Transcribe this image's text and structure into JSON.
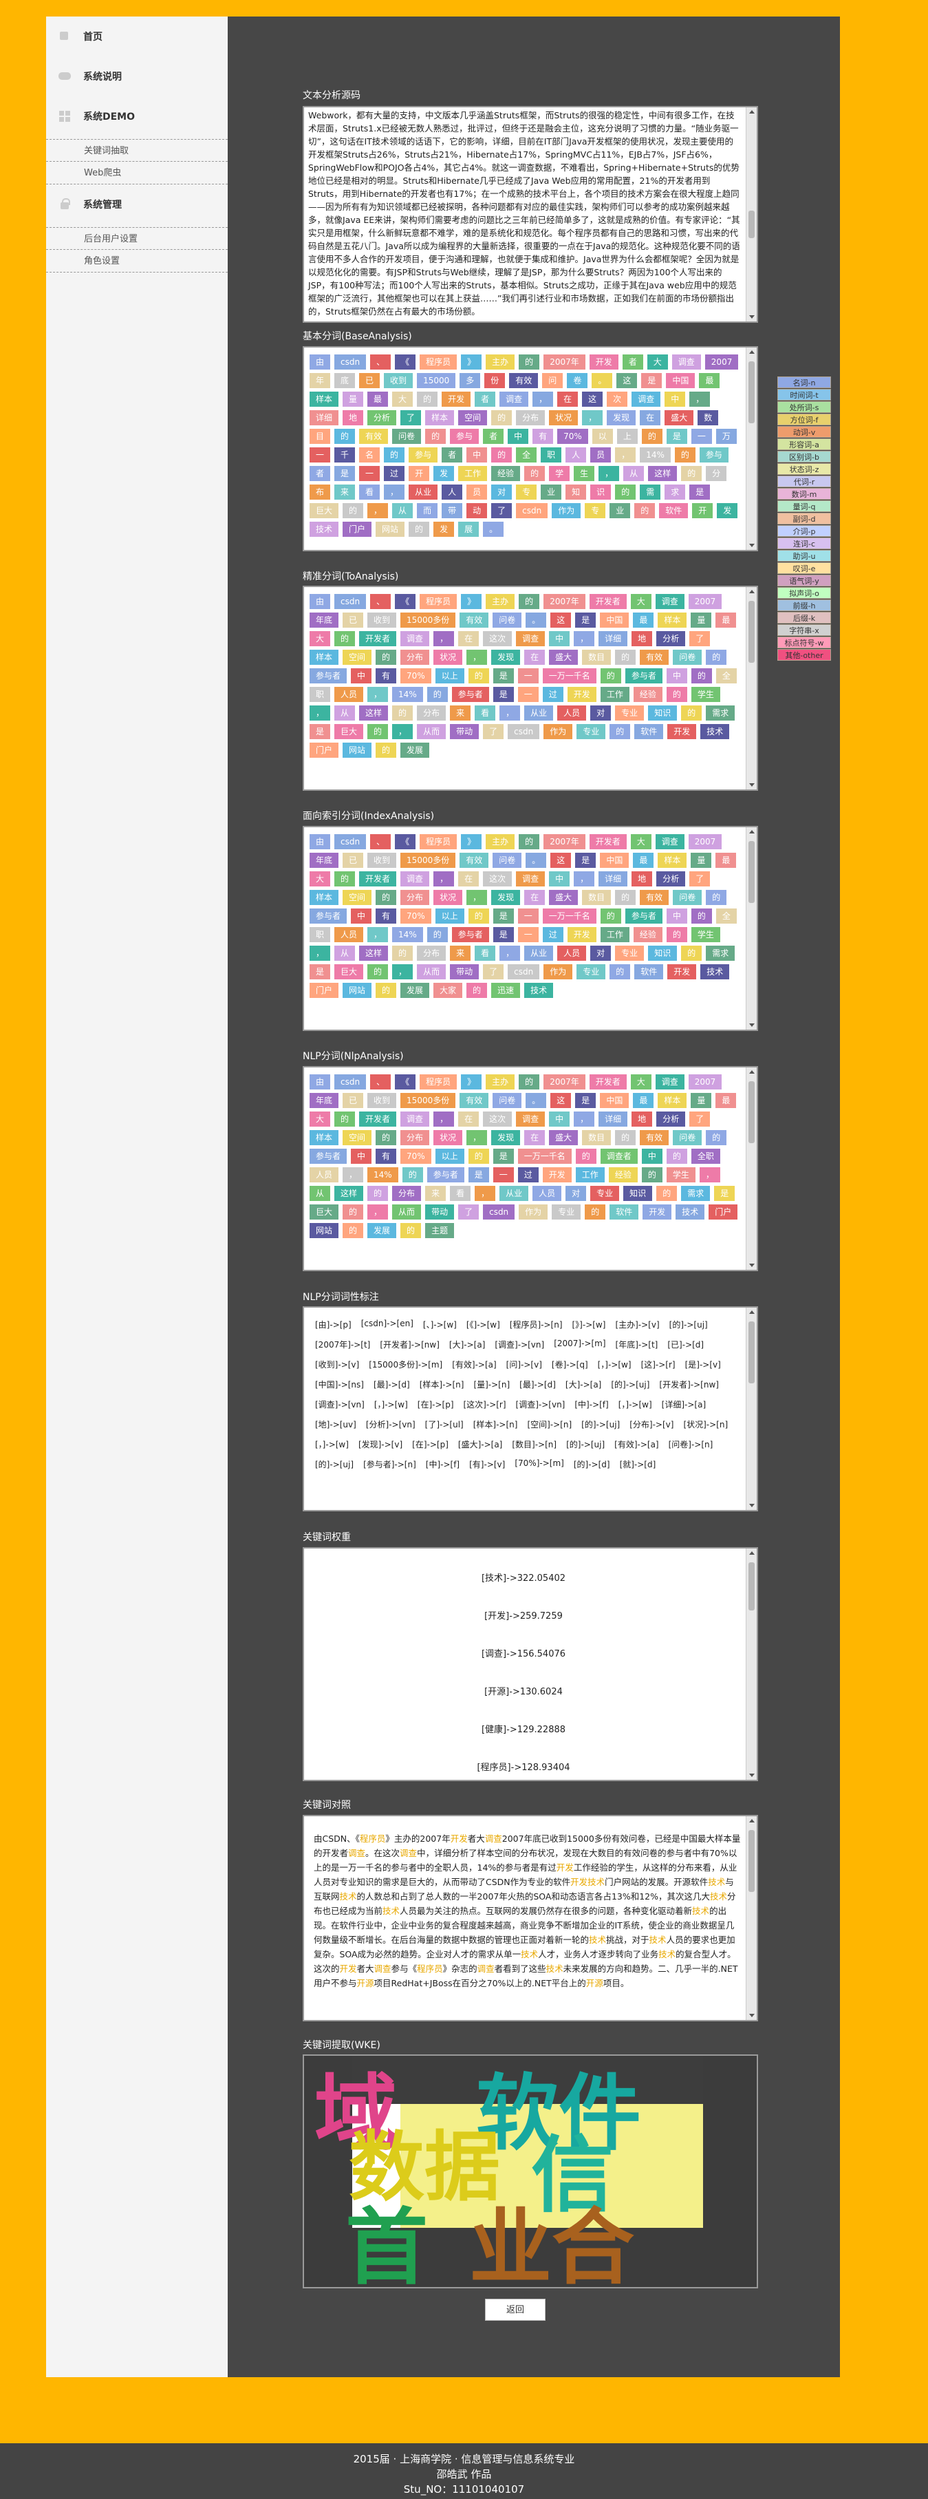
{
  "sidebar": {
    "nav": [
      {
        "label": "首页",
        "icon": "home-icon"
      },
      {
        "label": "系统说明",
        "icon": "chat-icon"
      },
      {
        "label": "系统DEMO",
        "icon": "grid-icon"
      }
    ],
    "demo_sub": [
      "关键词抽取",
      "Web爬虫"
    ],
    "admin": {
      "label": "系统管理",
      "icon": "lock-icon"
    },
    "admin_sub": [
      "后台用户设置",
      "角色设置"
    ]
  },
  "sections": {
    "source": "文本分析源码",
    "base": "基本分词(BaseAnalysis)",
    "to": "精准分词(ToAnalysis)",
    "index": "面向索引分词(IndexAnalysis)",
    "nlp": "NLP分词(NlpAnalysis)",
    "nlp_attr": "NLP分词词性标注",
    "weight": "关键词权重",
    "highlight": "关键词对照",
    "cloud": "关键词提取(WKE)"
  },
  "source_text": "Webwork，都有大量的支持，中文版本几乎涵盖Struts框架，而Struts的很强的稳定性，中间有很多工作，在技术层面，Struts1.x已经被无数人熟悉过，批评过，但终于还是融会主位，这充分说明了习惯的力量。“随业务驱一切”，这句话在IT技术领域的话语下，它的影响，详细，目前在IT部门Java开发框架的使用状况，发现主要使用的开发框架Struts占26%，Struts占21%，Hibernate占17%，SpringMVC占11%，EJB占7%，JSF占6%，SpringWebFlow和POJO各占4%，其它占4%。就这一调查数据，不难看出，Spring+Hibernate+Struts的优势地位已经是相对的明显。Struts和Hibernate几乎已经成了Java Web应用的常用配置，21%的开发者用到Struts，用到Hibernate的开发者也有17%；在一个成熟的技术平台上，各个项目的技术方案会在很大程度上趋同——因为所有有为知识领域都已经被探明，各种问题都有对应的最佳实践，架构师们可以参考的成功案例越来越多，就像Java EE来讲，架构师们需要考虑的问题比之三年前已经简单多了，这就是成熟的价值。有专家评论：“其实只是用框架，什么新鲜玩意都不难学，难的是系统化和规范化。每个程序员都有自己的思路和习惯，写出来的代码自然是五花八门。Java所以成为编程界的大量新选择，很重要的一点在于Java的规范化。这种规范化要不同的语言使用不多人合作的开发项目，便于沟通和理解，也就便于集成和维护。Java世界为什么会都框架呢？全因为就是以规范化化的需要。有JSP和Struts与Web继续，理解了是JSP，那为什么要Struts？两因为100个人写出来的JSP，有100种写法；而100个人写出来的Struts，基本相似。Struts之成功，正缘于其在Java web应用中的规范框架的广泛流行，其他框架也可以在其上获益……”我们再引述行业和市场数据，正如我们在前面的市场份额指出的，Struts框架仍然在占有最大的市场份额。",
  "tag_colors": [
    "#c9c9c9",
    "#72c471",
    "#5bb8df",
    "#8fa8e4",
    "#a06ec4",
    "#f09090",
    "#5a5aa0",
    "#ef9a4a",
    "#3cb4a0",
    "#eed555",
    "#86a8e0",
    "#e4d3a6",
    "#ee7ba8",
    "#ffa57e",
    "#70c8c8",
    "#cfa1e0",
    "#66aa88",
    "#e46060"
  ],
  "base_tokens": [
    "由",
    "csdn",
    "、",
    "《",
    "程序员",
    "》",
    "主办",
    "的",
    "2007年",
    "开发",
    "者",
    "大",
    "调查",
    "2007",
    "年",
    "底",
    "已",
    "收到",
    "15000",
    "多",
    "份",
    "有效",
    "问",
    "卷",
    "。",
    "这",
    "是",
    "中国",
    "最",
    "样本",
    "量",
    "最",
    "大",
    "的",
    "开发",
    "者",
    "调查",
    "，",
    "在",
    "这",
    "次",
    "调查",
    "中",
    "，",
    "详细",
    "地",
    "分析",
    "了",
    "样本",
    "空间",
    "的",
    "分布",
    "状况",
    "，",
    "发现",
    "在",
    "盛大",
    "数",
    "目",
    "的",
    "有效",
    "问卷",
    "的",
    "参与",
    "者",
    "中",
    "有",
    "70%",
    "以",
    "上",
    "的",
    "是",
    "一",
    "万",
    "一",
    "千",
    "名",
    "的",
    "参与",
    "者",
    "中",
    "的",
    "全",
    "职",
    "人",
    "员",
    "，",
    "14%",
    "的",
    "参与",
    "者",
    "是",
    "一",
    "过",
    "开",
    "发",
    "工作",
    "经验",
    "的",
    "学",
    "生",
    "，",
    "从",
    "这样",
    "的",
    "分",
    "布",
    "来",
    "看",
    "，",
    "从业",
    "人",
    "员",
    "对",
    "专",
    "业",
    "知",
    "识",
    "的",
    "需",
    "求",
    "是",
    "巨大",
    "的",
    "，",
    "从",
    "而",
    "带",
    "动",
    "了",
    "csdn",
    "作为",
    "专",
    "业",
    "的",
    "软件",
    "开",
    "发",
    "技术",
    "门户",
    "网站",
    "的",
    "发",
    "展",
    "。"
  ],
  "to_tokens": [
    "由",
    "csdn",
    "、",
    "《",
    "程序员",
    "》",
    "主办",
    "的",
    "2007年",
    "开发者",
    "大",
    "调查",
    "2007",
    "年底",
    "已",
    "收到",
    "15000多份",
    "有效",
    "问卷",
    "。",
    "这",
    "是",
    "中国",
    "最",
    "样本",
    "量",
    "最",
    "大",
    "的",
    "开发者",
    "调查",
    "，",
    "在",
    "这次",
    "调查",
    "中",
    "，",
    "详细",
    "地",
    "分析",
    "了",
    "样本",
    "空间",
    "的",
    "分布",
    "状况",
    "，",
    "发现",
    "在",
    "盛大",
    "数目",
    "的",
    "有效",
    "问卷",
    "的",
    "参与者",
    "中",
    "有",
    "70%",
    "以上",
    "的",
    "是",
    "一",
    "一万一千名",
    "的",
    "参与者",
    "中",
    "的",
    "全",
    "职",
    "人员",
    "，",
    "14%",
    "的",
    "参与者",
    "是",
    "一",
    "过",
    "开发",
    "工作",
    "经验",
    "的",
    "学生",
    "，",
    "从",
    "这样",
    "的",
    "分布",
    "来",
    "看",
    "，",
    "从业",
    "人员",
    "对",
    "专业",
    "知识",
    "的",
    "需求",
    "是",
    "巨大",
    "的",
    "，",
    "从而",
    "带动",
    "了",
    "csdn",
    "作为",
    "专业",
    "的",
    "软件",
    "开发",
    "技术",
    "门户",
    "网站",
    "的",
    "发展"
  ],
  "index_tokens": [
    "由",
    "csdn",
    "、",
    "《",
    "程序员",
    "》",
    "主办",
    "的",
    "2007年",
    "开发者",
    "大",
    "调查",
    "2007",
    "年底",
    "已",
    "收到",
    "15000多份",
    "有效",
    "问卷",
    "。",
    "这",
    "是",
    "中国",
    "最",
    "样本",
    "量",
    "最",
    "大",
    "的",
    "开发者",
    "调查",
    "，",
    "在",
    "这次",
    "调查",
    "中",
    "，",
    "详细",
    "地",
    "分析",
    "了",
    "样本",
    "空间",
    "的",
    "分布",
    "状况",
    "，",
    "发现",
    "在",
    "盛大",
    "数目",
    "的",
    "有效",
    "问卷",
    "的",
    "参与者",
    "中",
    "有",
    "70%",
    "以上",
    "的",
    "是",
    "一",
    "一万一千名",
    "的",
    "参与者",
    "中",
    "的",
    "全",
    "职",
    "人员",
    "，",
    "14%",
    "的",
    "参与者",
    "是",
    "一",
    "过",
    "开发",
    "工作",
    "经验",
    "的",
    "学生",
    "，",
    "从",
    "这样",
    "的",
    "分布",
    "来",
    "看",
    "，",
    "从业",
    "人员",
    "对",
    "专业",
    "知识",
    "的",
    "需求",
    "是",
    "巨大",
    "的",
    "，",
    "从而",
    "带动",
    "了",
    "csdn",
    "作为",
    "专业",
    "的",
    "软件",
    "开发",
    "技术",
    "门户",
    "网站",
    "的",
    "发展",
    "大家",
    "的",
    "迅速",
    "技术"
  ],
  "nlp_tokens": [
    "由",
    "csdn",
    "、",
    "《",
    "程序员",
    "》",
    "主办",
    "的",
    "2007年",
    "开发者",
    "大",
    "调查",
    "2007",
    "年底",
    "已",
    "收到",
    "15000多份",
    "有效",
    "问卷",
    "。",
    "这",
    "是",
    "中国",
    "最",
    "样本",
    "量",
    "最",
    "大",
    "的",
    "开发者",
    "调查",
    "，",
    "在",
    "这次",
    "调查",
    "中",
    "，",
    "详细",
    "地",
    "分析",
    "了",
    "样本",
    "空间",
    "的",
    "分布",
    "状况",
    "，",
    "发现",
    "在",
    "盛大",
    "数目",
    "的",
    "有效",
    "问卷",
    "的",
    "参与者",
    "中",
    "有",
    "70%",
    "以上",
    "的",
    "是",
    "一万一千名",
    "的",
    "调查者",
    "中",
    "的",
    "全职",
    "人员",
    "，",
    "14%",
    "的",
    "参与者",
    "是",
    "一",
    "过",
    "开发",
    "工作",
    "经验",
    "的",
    "学生",
    "，",
    "从",
    "这样",
    "的",
    "分布",
    "来",
    "看",
    "，",
    "从业",
    "人员",
    "对",
    "专业",
    "知识",
    "的",
    "需求",
    "是",
    "巨大",
    "的",
    "，",
    "从而",
    "带动",
    "了",
    "csdn",
    "作为",
    "专业",
    "的",
    "软件",
    "开发",
    "技术",
    "门户",
    "网站",
    "的",
    "发展",
    "的",
    "主题"
  ],
  "nlp_attrs": [
    "[由]->[p]",
    "[csdn]->[en]",
    "[、]->[w]",
    "[《]->[w]",
    "[程序员]->[n]",
    "[》]->[w]",
    "[主办]->[v]",
    "[的]->[uj]",
    "[2007年]->[t]",
    "[开发者]->[nw]",
    "[大]->[a]",
    "[调查]->[vn]",
    "[2007]->[m]",
    "[年底]->[t]",
    "[已]->[d]",
    "[收到]->[v]",
    "[15000多份]->[m]",
    "[有效]->[a]",
    "[问]->[v]",
    "[卷]->[q]",
    "[，]->[w]",
    "[这]->[r]",
    "[是]->[v]",
    "[中国]->[ns]",
    "[最]->[d]",
    "[样本]->[n]",
    "[量]->[n]",
    "[最]->[d]",
    "[大]->[a]",
    "[的]->[uj]",
    "[开发者]->[nw]",
    "[调查]->[vn]",
    "[，]->[w]",
    "[在]->[p]",
    "[这次]->[r]",
    "[调查]->[vn]",
    "[中]->[f]",
    "[，]->[w]",
    "[详细]->[a]",
    "[地]->[uv]",
    "[分析]->[vn]",
    "[了]->[ul]",
    "[样本]->[n]",
    "[空间]->[n]",
    "[的]->[uj]",
    "[分布]->[v]",
    "[状况]->[n]",
    "[，]->[w]",
    "[发现]->[v]",
    "[在]->[p]",
    "[盛大]->[a]",
    "[数目]->[n]",
    "[的]->[uj]",
    "[有效]->[a]",
    "[问卷]->[n]",
    "[的]->[uj]",
    "[参与者]->[n]",
    "[中]->[f]",
    "[有]->[v]",
    "[70%]->[m]",
    "[的]->[d]",
    "[就]->[d]"
  ],
  "weights": [
    "[技术]->322.05402",
    "[开发]->259.7259",
    "[调查]->156.54076",
    "[开源]->130.6024",
    "[健康]->129.22888",
    "[程序员]->128.93404"
  ],
  "highlight_text": [
    {
      "t": "由CSDN、《"
    },
    {
      "t": "程序员",
      "k": 1
    },
    {
      "t": "》主办的2007年"
    },
    {
      "t": "开发",
      "k": 1
    },
    {
      "t": "者大"
    },
    {
      "t": "调查",
      "k": 1
    },
    {
      "t": "2007年底已收到15000多份有效问卷，已经是中国最大样本量的开发者"
    },
    {
      "t": "调查",
      "k": 1
    },
    {
      "t": "。在这次"
    },
    {
      "t": "调查",
      "k": 1
    },
    {
      "t": "中，详细分析了样本空间的分布状况，发现在大数目的有效问卷的参与者中有70%以上的是一万一千名的参与者中的全职人员，14%的参与者是有过"
    },
    {
      "t": "开发",
      "k": 1
    },
    {
      "t": "工作经验的学生，从这样的分布来看，从业人员对专业知识的需求是巨大的，从而带动了CSDN作为专业的软件"
    },
    {
      "t": "开发",
      "k": 1
    },
    {
      "t": "技术",
      "k": 1
    },
    {
      "t": "门户网站的发展。开源软件"
    },
    {
      "t": "技术",
      "k": 1
    },
    {
      "t": "与互联网"
    },
    {
      "t": "技术",
      "k": 1
    },
    {
      "t": "的人数总和占到了总人数的一半2007年火热的SOA和动态语言各占13%和12%，其次这几大"
    },
    {
      "t": "技术",
      "k": 1
    },
    {
      "t": "分布也已经成为当前"
    },
    {
      "t": "技术",
      "k": 1
    },
    {
      "t": "人员最为关注的热点。互联网的发展仍然存在很多的问题，各种变化驱动着新"
    },
    {
      "t": "技术",
      "k": 1
    },
    {
      "t": "的出现。在软件行业中，企业中业务的复合程度越来越高，商业竞争不断增加企业的IT系统，使企业的商业数据呈几何数量级不断增长。在后台海量的数据中数据的管理也正面对着新一轮的"
    },
    {
      "t": "技术",
      "k": 1
    },
    {
      "t": "挑战，对于"
    },
    {
      "t": "技术",
      "k": 1
    },
    {
      "t": "人员的要求也更加复杂。SOA成为必然的趋势。企业对人才的需求从单一"
    },
    {
      "t": "技术",
      "k": 1
    },
    {
      "t": "人才，业务人才逐步转向了业务"
    },
    {
      "t": "技术",
      "k": 1
    },
    {
      "t": "的复合型人才。这次的"
    },
    {
      "t": "开发",
      "k": 1
    },
    {
      "t": "者大"
    },
    {
      "t": "调查",
      "k": 1
    },
    {
      "t": "参与《"
    },
    {
      "t": "程序员",
      "k": 1
    },
    {
      "t": "》杂志的"
    },
    {
      "t": "调查",
      "k": 1
    },
    {
      "t": "者看到了这些"
    },
    {
      "t": "技术",
      "k": 1
    },
    {
      "t": "未来发展的方向和趋势。二、几乎一半的.NET用户不参与"
    },
    {
      "t": "开源",
      "k": 1
    },
    {
      "t": "项目RedHat+JBoss在百分之70%以上的.NET平台上的"
    },
    {
      "t": "开源",
      "k": 1
    },
    {
      "t": "项目。"
    }
  ],
  "legend": [
    "名词-n",
    "时间词-t",
    "处所词-s",
    "方位词-f",
    "动词-v",
    "形容词-a",
    "区别词-b",
    "状态词-z",
    "代词-r",
    "数词-m",
    "量词-q",
    "副词-d",
    "介词-p",
    "连词-c",
    "助词-u",
    "叹词-e",
    "语气词-y",
    "拟声词-o",
    "前缀-h",
    "后缀-k",
    "字符串-x",
    "标点符号-w",
    "其他-other"
  ],
  "legend_colors": [
    "#8fa8e4",
    "#86c4ea",
    "#a9e0a0",
    "#e8d06c",
    "#ee9c6c",
    "#d4e4a0",
    "#a6d8d0",
    "#e8e8a8",
    "#c8c8f0",
    "#e8b4d8",
    "#b4e8c8",
    "#f0c0a0",
    "#c0d0ff",
    "#d8c0f0",
    "#a0e0e8",
    "#ffe0a0",
    "#d0a0c0",
    "#c0ffc0",
    "#a0c0e0",
    "#e0c0c0",
    "#d0d0d0",
    "#ff9bb8",
    "#f05080"
  ],
  "cloud_words": [
    {
      "w": "域",
      "c": "#e0448a"
    },
    {
      "w": "软件",
      "c": "#17a8a0"
    },
    {
      "w": "数据",
      "c": "#dccc1a"
    },
    {
      "w": "信",
      "c": "#21b39b"
    },
    {
      "w": "首",
      "c": "#20a050"
    },
    {
      "w": "业合",
      "c": "#a8611e"
    }
  ],
  "back_label": "返回",
  "footer": [
    "2015届 · 上海商学院 · 信息管理与信息系统专业",
    "邵皓武 作品",
    "Stu_NO：11101040107"
  ]
}
